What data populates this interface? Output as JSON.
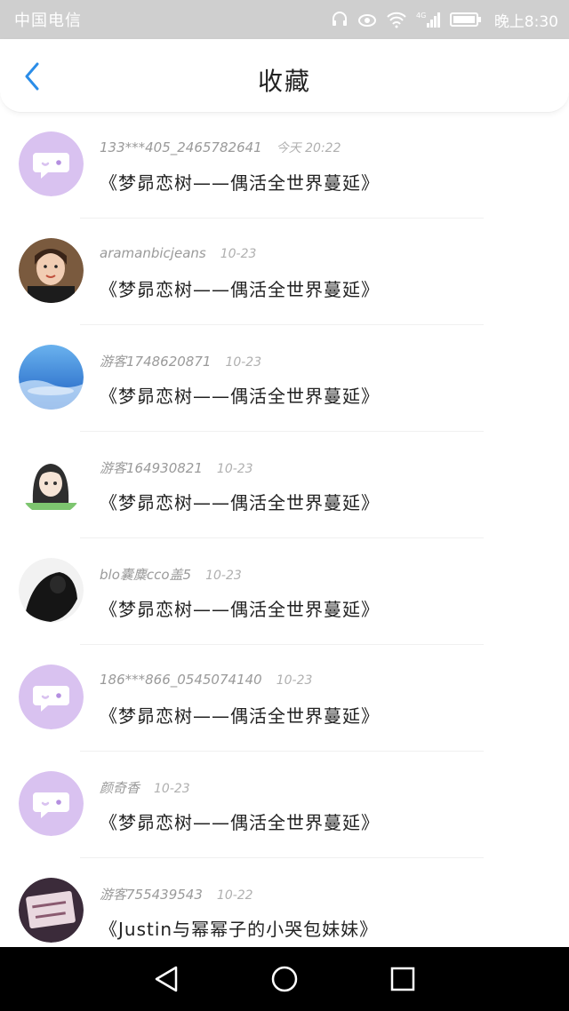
{
  "status_bar": {
    "carrier": "中国电信",
    "network": "4G",
    "time": "晚上8:30",
    "icons": [
      "headset-icon",
      "eye-icon",
      "wifi-icon",
      "signal-icon",
      "battery-icon"
    ]
  },
  "header": {
    "title": "收藏",
    "back_icon": "chevron-left-icon",
    "accent_color": "#2b8de8"
  },
  "favorites": [
    {
      "user": "133***405_2465782641",
      "date": "今天 20:22",
      "subject": "《梦昴恋树——偶活全世界蔓延》",
      "avatar": "default-chat-avatar"
    },
    {
      "user": "aramanbicjeans",
      "date": "10-23",
      "subject": "《梦昴恋树——偶活全世界蔓延》",
      "avatar": "photo-girl-avatar"
    },
    {
      "user": "游客1748620871",
      "date": "10-23",
      "subject": "《梦昴恋树——偶活全世界蔓延》",
      "avatar": "blue-landscape-avatar"
    },
    {
      "user": "游客164930821",
      "date": "10-23",
      "subject": "《梦昴恋树——偶活全世界蔓延》",
      "avatar": "anime-girl-avatar"
    },
    {
      "user": "blo囊麋cco盖5",
      "date": "10-23",
      "subject": "《梦昴恋树——偶活全世界蔓延》",
      "avatar": "dark-photo-avatar"
    },
    {
      "user": "186***866_0545074140",
      "date": "10-23",
      "subject": "《梦昴恋树——偶活全世界蔓延》",
      "avatar": "default-chat-avatar"
    },
    {
      "user": "颜奇香",
      "date": "10-23",
      "subject": "《梦昴恋树——偶活全世界蔓延》",
      "avatar": "default-chat-avatar"
    },
    {
      "user": "游客755439543",
      "date": "10-22",
      "subject": "《Justin与幂幂子的小哭包妹妹》",
      "avatar": "smile-sign-avatar"
    }
  ],
  "nav_bar": {
    "buttons": [
      "back-triangle-icon",
      "home-circle-icon",
      "recents-square-icon"
    ]
  },
  "colors": {
    "default_avatar": "#d9c2f0",
    "status_bar_bg": "#cfcfcf",
    "nav_bar_bg": "#000000"
  }
}
